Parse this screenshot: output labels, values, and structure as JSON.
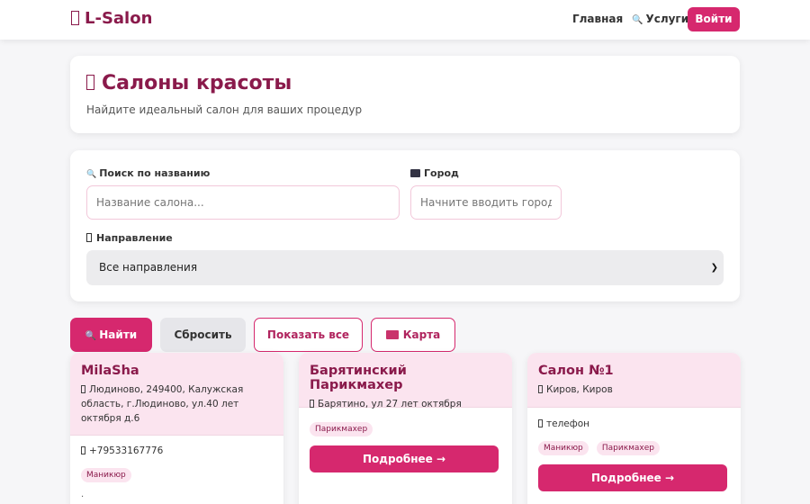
{
  "nav": {
    "brand": "L-Salon",
    "home": "Главная",
    "services": "Услуги",
    "login": "Войти"
  },
  "hero": {
    "title": "Салоны красоты",
    "subtitle": "Найдите идеальный салон для ваших процедур"
  },
  "filters": {
    "name_label": "Поиск по названию",
    "name_placeholder": "Название салона...",
    "city_label": "Город",
    "city_placeholder": "Начните вводить город...",
    "direction_label": "Направление",
    "direction_value": "Все направления"
  },
  "actions": {
    "find": "Найти",
    "reset": "Сбросить",
    "show_all": "Показать все",
    "map": "Карта"
  },
  "salons": [
    {
      "name": "MilaSha",
      "address": "Людиново, 249400, Калужская область, г.Людиново, ул.40 лет октября д.6",
      "phone": "+79533167776",
      "tags": [
        "Маникюр"
      ],
      "extra": "."
    },
    {
      "name": "Барятинский Парикмахер",
      "address": "Барятино, ул 27 лет октября",
      "tags": [
        "Парикмахер"
      ],
      "button": "Подробнее →"
    },
    {
      "name": "Салон №1",
      "address": "Киров, Киров",
      "phone": "телефон",
      "tags": [
        "Маникюр",
        "Парикмахер"
      ],
      "button": "Подробнее →"
    }
  ]
}
